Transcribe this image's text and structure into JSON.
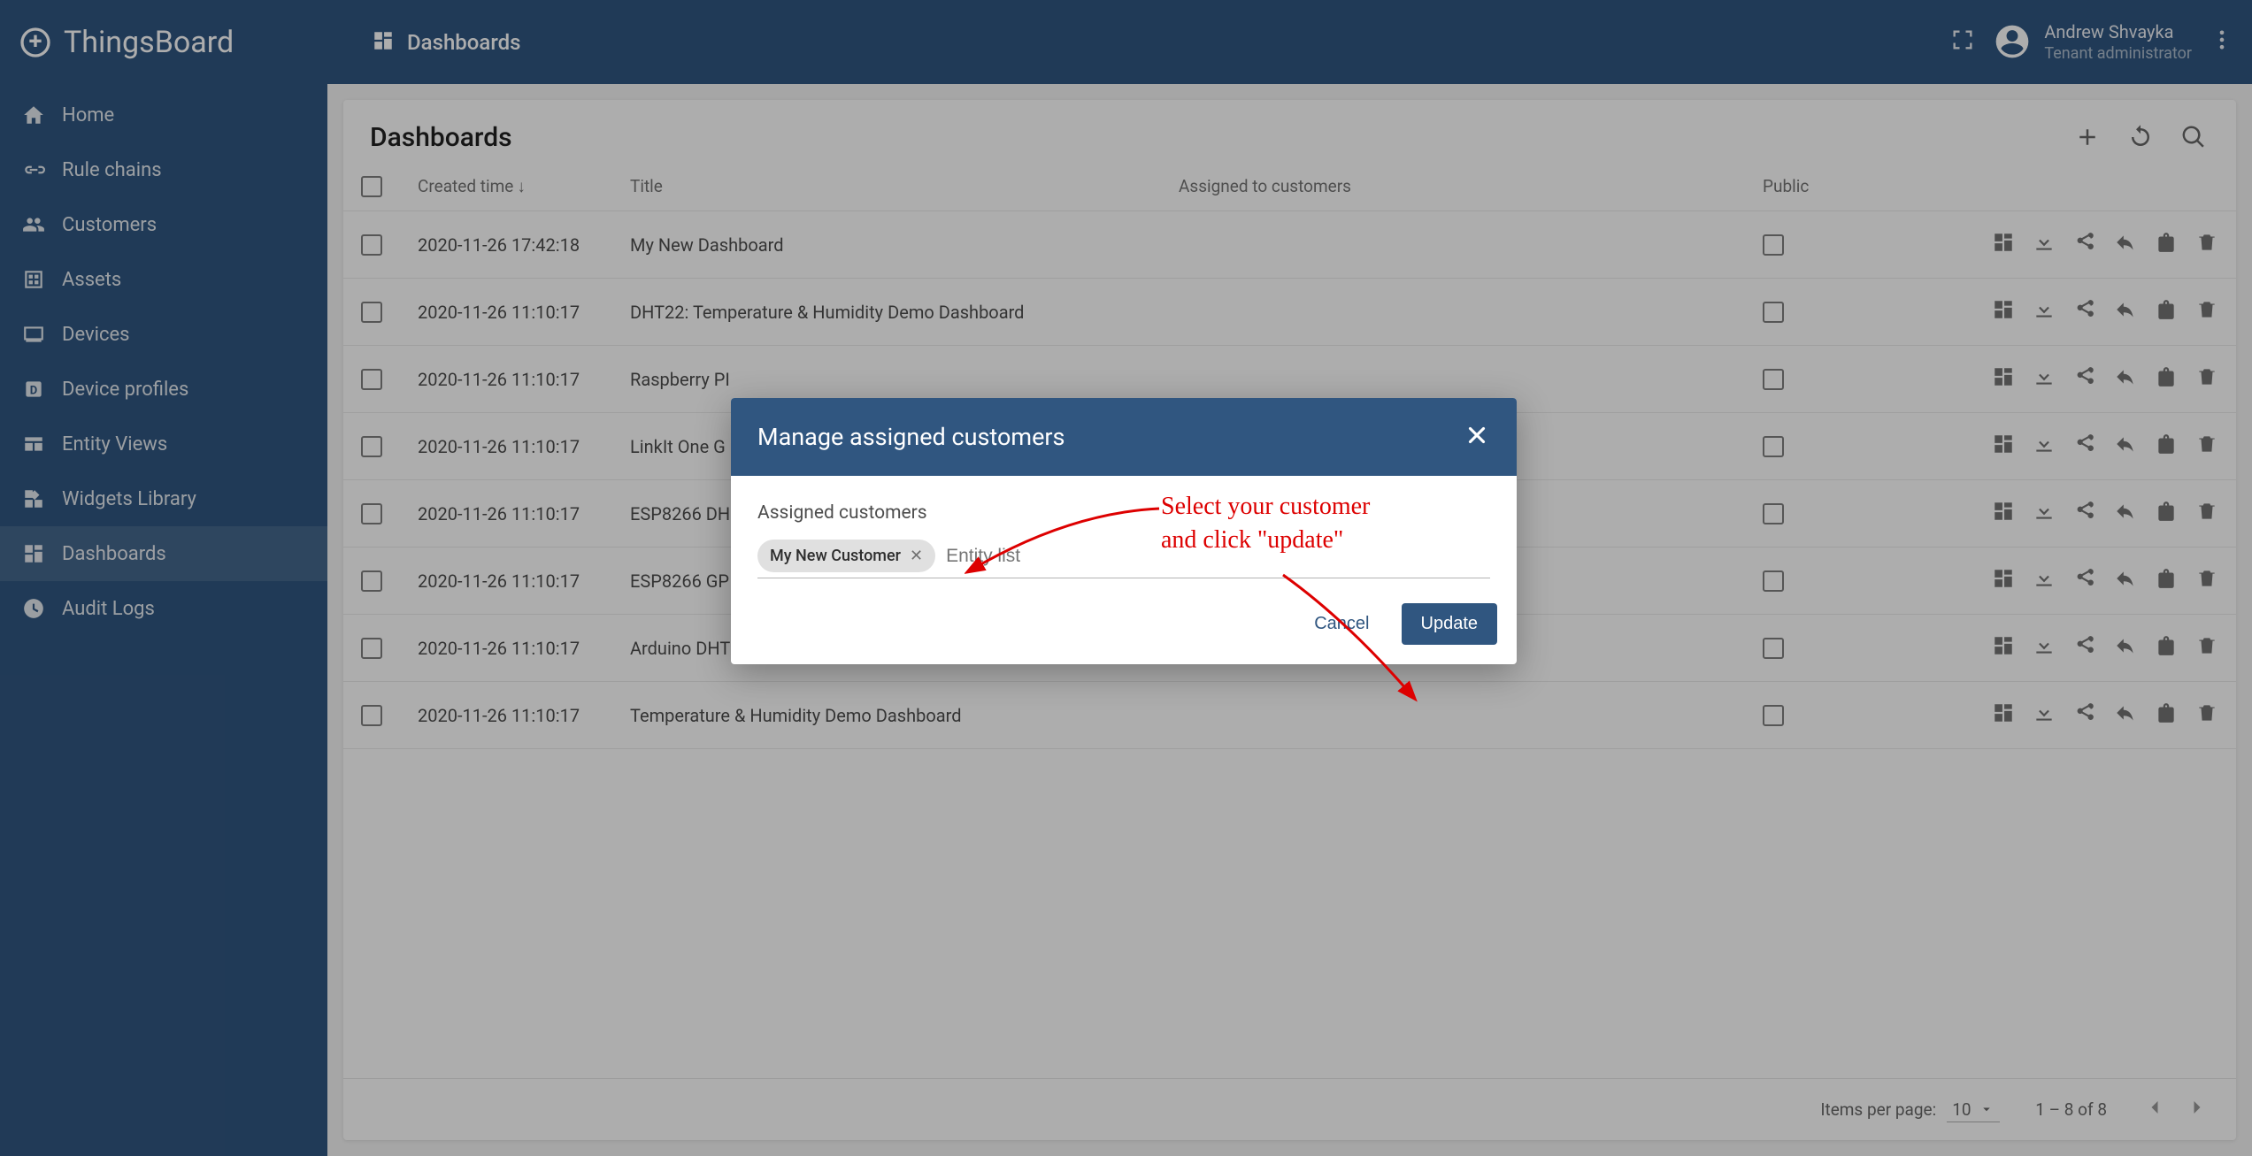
{
  "app": {
    "title": "ThingsBoard",
    "breadcrumb_label": "Dashboards"
  },
  "user": {
    "name": "Andrew Shvayka",
    "role": "Tenant administrator"
  },
  "sidebar": {
    "items": [
      {
        "label": "Home",
        "icon": "home"
      },
      {
        "label": "Rule chains",
        "icon": "chains"
      },
      {
        "label": "Customers",
        "icon": "customers"
      },
      {
        "label": "Assets",
        "icon": "assets"
      },
      {
        "label": "Devices",
        "icon": "devices"
      },
      {
        "label": "Device profiles",
        "icon": "profiles"
      },
      {
        "label": "Entity Views",
        "icon": "entity-views"
      },
      {
        "label": "Widgets Library",
        "icon": "widgets"
      },
      {
        "label": "Dashboards",
        "icon": "dashboards",
        "active": true
      },
      {
        "label": "Audit Logs",
        "icon": "audit"
      }
    ]
  },
  "card": {
    "title": "Dashboards"
  },
  "table": {
    "headers": {
      "created": "Created time",
      "title": "Title",
      "assigned": "Assigned to customers",
      "public": "Public"
    },
    "rows": [
      {
        "created": "2020-11-26 17:42:18",
        "title": "My New Dashboard"
      },
      {
        "created": "2020-11-26 11:10:17",
        "title": "DHT22: Temperature & Humidity Demo Dashboard"
      },
      {
        "created": "2020-11-26 11:10:17",
        "title": "Raspberry PI"
      },
      {
        "created": "2020-11-26 11:10:17",
        "title": "LinkIt One G"
      },
      {
        "created": "2020-11-26 11:10:17",
        "title": "ESP8266 DH"
      },
      {
        "created": "2020-11-26 11:10:17",
        "title": "ESP8266 GP"
      },
      {
        "created": "2020-11-26 11:10:17",
        "title": "Arduino DHT"
      },
      {
        "created": "2020-11-26 11:10:17",
        "title": "Temperature & Humidity Demo Dashboard"
      }
    ]
  },
  "pagination": {
    "items_per_page_label": "Items per page:",
    "page_size": "10",
    "range": "1 – 8 of 8"
  },
  "dialog": {
    "title": "Manage assigned customers",
    "field_label": "Assigned customers",
    "chip": "My New Customer",
    "placeholder": "Entity list",
    "cancel": "Cancel",
    "update": "Update"
  },
  "annotation": {
    "line1": "Select your customer",
    "line2": "and click \"update\""
  }
}
